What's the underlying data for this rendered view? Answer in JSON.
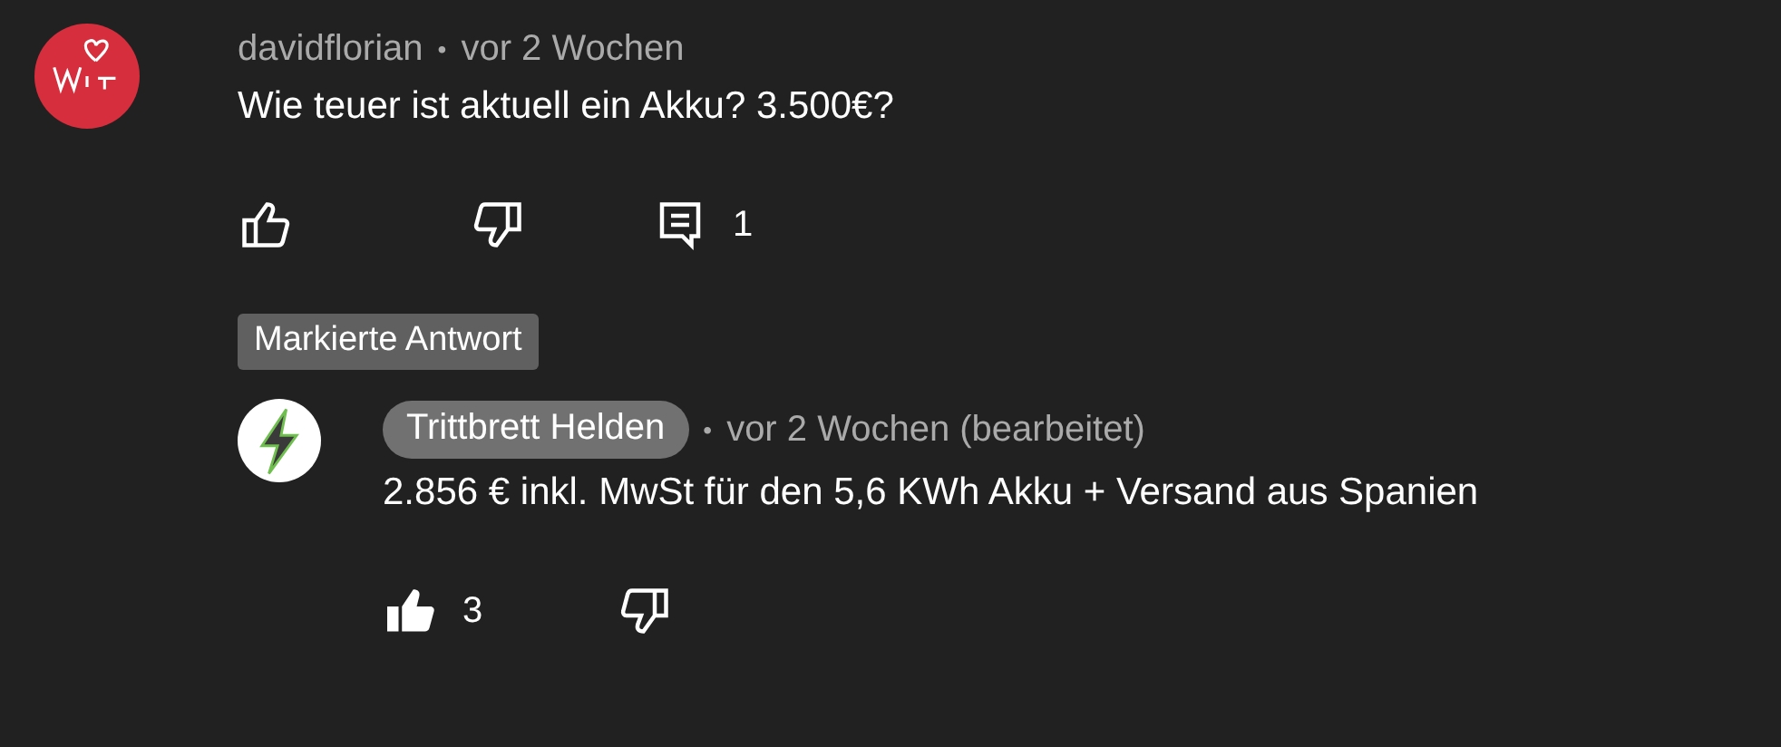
{
  "comment": {
    "author": "davidflorian",
    "author_highlighted": false,
    "separator": "•",
    "time": "vor 2 Wochen",
    "text": "Wie teuer ist aktuell ein Akku? 3.500€?",
    "liked": false,
    "disliked": false,
    "reply_count": "1"
  },
  "marked_label": "Markierte Antwort",
  "reply": {
    "author": "Trittbrett Helden",
    "author_highlighted": true,
    "separator": "•",
    "time": "vor 2 Wochen (bearbeitet)",
    "text": "2.856 € inkl. MwSt für den 5,6 KWh Akku + Versand aus Spanien",
    "liked": true,
    "like_count": "3",
    "disliked": false
  }
}
